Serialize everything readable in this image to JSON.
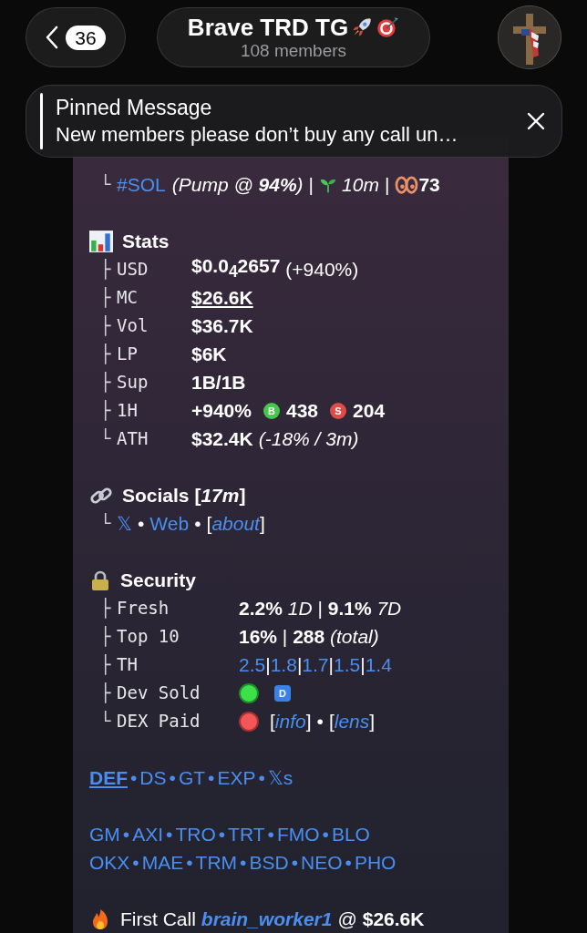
{
  "header": {
    "back_count": "36",
    "title": "Brave TRD TG",
    "subtitle": "108 members"
  },
  "pinned": {
    "title": "Pinned Message",
    "text": "New members please don’t buy any call un…"
  },
  "token_line": {
    "branch": "└",
    "tag": "#SOL",
    "pump": "(Pump @ **94%**)",
    "separator": "|",
    "age": "10m",
    "separator_2": "|",
    "views": "73"
  },
  "stats": {
    "title": "Stats",
    "rows": [
      {
        "kind": "value",
        "branch": "├",
        "label": "USD",
        "value": "$0.0$_{4}$2657",
        "note": "(+940%)",
        "note_italic": false
      },
      {
        "kind": "link",
        "branch": "├",
        "label": "MC",
        "value": "$26.6K"
      },
      {
        "kind": "value",
        "branch": "├",
        "label": "Vol",
        "value": "$36.7K"
      },
      {
        "kind": "value",
        "branch": "├",
        "label": "LP",
        "value": "$6K"
      },
      {
        "kind": "value",
        "branch": "├",
        "label": "Sup",
        "value": "1B/1B"
      },
      {
        "kind": "trades",
        "branch": "├",
        "label": "1H",
        "value": "+940%",
        "buy_badge": "B",
        "buys": "438",
        "sell_badge": "S",
        "sells": "204"
      },
      {
        "kind": "value",
        "branch": "└",
        "label": "ATH",
        "value": "$32.4K",
        "note": "(-18% / 3m)",
        "note_italic": true
      }
    ]
  },
  "socials": {
    "title": "Socials [*17m*]",
    "branch": "└",
    "links": [
      "𝕏",
      "Web"
    ],
    "dot": "•",
    "bracket_open": "[",
    "about": "about",
    "bracket_close": "]"
  },
  "security": {
    "title": "Security",
    "rows": [
      {
        "kind": "text",
        "branch": "├",
        "label": "Fresh",
        "value": "**2.2%** *1D* | **9.1%** *7D*"
      },
      {
        "kind": "text",
        "branch": "├",
        "label": "Top 10",
        "value": "**16%** | **288** *(total)*"
      },
      {
        "kind": "holders",
        "branch": "├",
        "label": "TH",
        "values": [
          "2.5",
          "1.8",
          "1.7",
          "1.5",
          "1.4"
        ],
        "separator": "|"
      },
      {
        "kind": "status",
        "branch": "├",
        "label": "Dev Sold",
        "on": true,
        "badge": "D"
      },
      {
        "kind": "status_links",
        "branch": "└",
        "label": "DEX Paid",
        "on": false,
        "links": [
          "info",
          "lens"
        ],
        "dot": "•",
        "bracket_open": "[",
        "bracket_close": "]"
      }
    ]
  },
  "links": {
    "separator": "•",
    "rows": [
      [
        {
          "label": "DEF",
          "selected": true
        },
        {
          "label": "DS",
          "selected": false
        },
        {
          "label": "GT",
          "selected": false
        },
        {
          "label": "EXP",
          "selected": false
        },
        {
          "label": "𝕏s",
          "selected": false
        }
      ],
      [
        {
          "label": "GM",
          "selected": false
        },
        {
          "label": "AXI",
          "selected": false
        },
        {
          "label": "TRO",
          "selected": false
        },
        {
          "label": "TRT",
          "selected": false
        },
        {
          "label": "FMO",
          "selected": false
        },
        {
          "label": "BLO",
          "selected": false
        }
      ],
      [
        {
          "label": "OKX",
          "selected": false
        },
        {
          "label": "MAE",
          "selected": false
        },
        {
          "label": "TRM",
          "selected": false
        },
        {
          "label": "BSD",
          "selected": false
        },
        {
          "label": "NEO",
          "selected": false
        },
        {
          "label": "PHO",
          "selected": false
        }
      ]
    ]
  },
  "first_call": {
    "label": "First Call",
    "user": "brain_worker1",
    "at": "@",
    "mc": "$26.6K"
  }
}
